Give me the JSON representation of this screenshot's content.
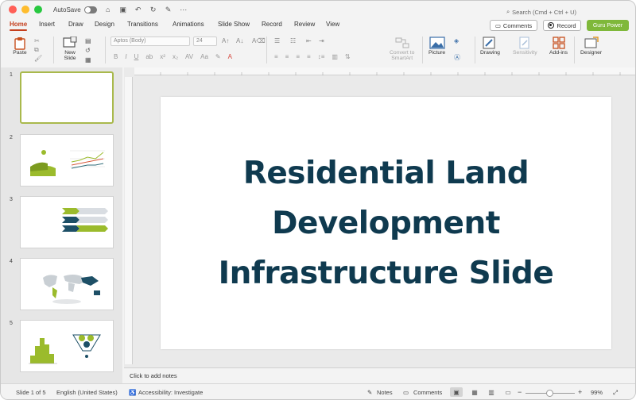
{
  "titlebar": {
    "autosave_label": "AutoSave",
    "search_placeholder": "Search (Cmd + Ctrl + U)"
  },
  "tabs": [
    "Home",
    "Insert",
    "Draw",
    "Design",
    "Transitions",
    "Animations",
    "Slide Show",
    "Record",
    "Review",
    "View"
  ],
  "actions": {
    "comments": "Comments",
    "record": "Record",
    "guru": "Guru Power"
  },
  "ribbon": {
    "paste": "Paste",
    "new_slide_line1": "New",
    "new_slide_line2": "Slide",
    "font_name": "Aptos (Body)",
    "font_size": "24",
    "convert_line1": "Convert to",
    "convert_line2": "SmartArt",
    "picture": "Picture",
    "drawing": "Drawing",
    "sensitivity": "Sensitivity",
    "addins": "Add-ins",
    "designer": "Designer"
  },
  "slides": [
    {
      "number": "1"
    },
    {
      "number": "2"
    },
    {
      "number": "3"
    },
    {
      "number": "4"
    },
    {
      "number": "5"
    }
  ],
  "slide": {
    "title_line1": "Residential Land",
    "title_line2": "Development",
    "title_line3": "Infrastructure Slide"
  },
  "notes_placeholder": "Click to add notes",
  "status": {
    "slide_count": "Slide 1 of 5",
    "language": "English (United States)",
    "accessibility": "Accessibility: Investigate",
    "notes": "Notes",
    "comments": "Comments",
    "zoom": "99%"
  },
  "colors": {
    "accent": "#c43e1c",
    "guru": "#7fb83a",
    "title": "#0f3a4f",
    "selected_thumb": "#a9b94c"
  }
}
